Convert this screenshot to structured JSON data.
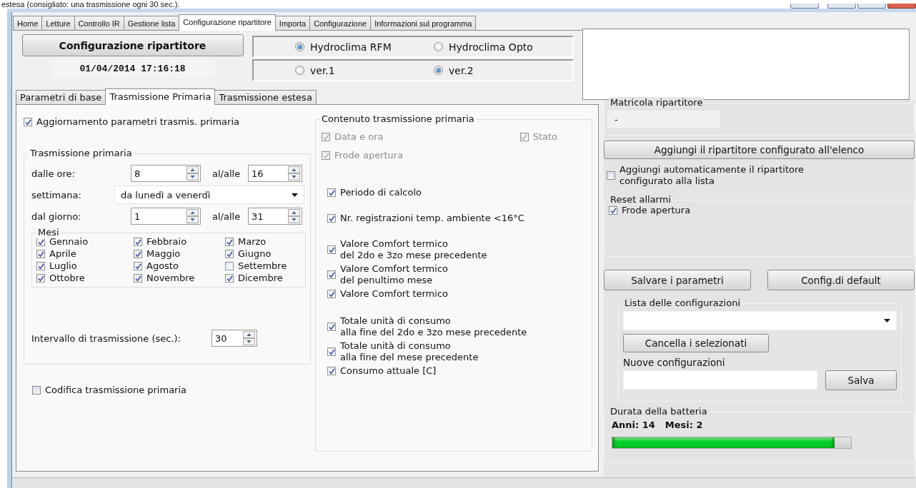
{
  "caption": "estesa (consigliato: una trasmissione ogni 30 sec.).",
  "main_tabs": [
    {
      "label": "Home",
      "selected": false
    },
    {
      "label": "Letture",
      "selected": false
    },
    {
      "label": "Controllo IR",
      "selected": false
    },
    {
      "label": "Gestione lista",
      "selected": false
    },
    {
      "label": "Configurazione ripartitore",
      "selected": true
    },
    {
      "label": "Importa",
      "selected": false
    },
    {
      "label": "Configurazione",
      "selected": false
    },
    {
      "label": "Informazioni sul programma",
      "selected": false
    }
  ],
  "header": {
    "button": "Configurazione ripartitore",
    "datetime": "01/04/2014 17:16:18",
    "device_options": [
      {
        "label": "Hydroclima RFM",
        "selected": true
      },
      {
        "label": "Hydroclima Opto",
        "selected": false
      }
    ],
    "version_options": [
      {
        "label": "ver.1",
        "selected": false
      },
      {
        "label": "ver.2",
        "selected": true
      }
    ]
  },
  "sub_tabs": [
    {
      "label": "Parametri di base",
      "selected": false
    },
    {
      "label": "Trasmissione Primaria",
      "selected": true
    },
    {
      "label": "Trasmissione estesa",
      "selected": false
    }
  ],
  "primary": {
    "update_params": {
      "label": "Aggiornamento parametri trasmis. primaria",
      "checked": true
    },
    "group": {
      "title": "Trasmissione primaria",
      "from_hour": {
        "label": "dalle ore:",
        "value": "8"
      },
      "to_hour": {
        "label": "al/alle",
        "value": "16"
      },
      "week": {
        "label": "settimana:",
        "value": "da lunedì a venerdì"
      },
      "from_day": {
        "label": "dal giorno:",
        "value": "1"
      },
      "to_day": {
        "label": "al/alle",
        "value": "31"
      },
      "months": {
        "title": "Mesi",
        "items": [
          {
            "label": "Gennaio",
            "checked": true
          },
          {
            "label": "Febbraio",
            "checked": true
          },
          {
            "label": "Marzo",
            "checked": true
          },
          {
            "label": "Aprile",
            "checked": true
          },
          {
            "label": "Maggio",
            "checked": true
          },
          {
            "label": "Giugno",
            "checked": true
          },
          {
            "label": "Luglio",
            "checked": true
          },
          {
            "label": "Agosto",
            "checked": true
          },
          {
            "label": "Settembre",
            "checked": false
          },
          {
            "label": "Ottobre",
            "checked": true
          },
          {
            "label": "Novembre",
            "checked": true
          },
          {
            "label": "Dicembre",
            "checked": true
          }
        ]
      },
      "interval": {
        "label": "Intervallo di trasmissione (sec.):",
        "value": "30"
      }
    },
    "encode": {
      "label": "Codifica trasmissione primaria",
      "checked": false
    }
  },
  "content": {
    "title": "Contenuto trasmissione primaria",
    "sections": [
      {
        "kind": "row",
        "items": [
          {
            "label": "Data e ora",
            "checked": true,
            "disabled": true
          },
          {
            "label": "Stato",
            "checked": true,
            "disabled": true
          }
        ]
      },
      {
        "kind": "column",
        "items": [
          {
            "label": "Frode apertura",
            "checked": true,
            "disabled": true
          }
        ]
      },
      {
        "kind": "column",
        "items": [
          {
            "label": "Periodo di calcolo",
            "checked": true,
            "disabled": false
          }
        ]
      },
      {
        "kind": "column",
        "items": [
          {
            "label": "Nr. registrazioni temp. ambiente <16°C",
            "checked": true,
            "disabled": false
          }
        ]
      },
      {
        "kind": "column",
        "items": [
          {
            "label": "Valore Comfort termico\ndel 2do e 3zo mese precedente",
            "checked": true,
            "disabled": false
          },
          {
            "label": "Valore Comfort termico\ndel penultimo mese",
            "checked": true,
            "disabled": false
          },
          {
            "label": "Valore Comfort termico",
            "checked": true,
            "disabled": false
          }
        ]
      },
      {
        "kind": "column",
        "items": [
          {
            "label": "Totale unità di consumo\nalla fine del 2do e 3zo mese precedente",
            "checked": true,
            "disabled": false
          },
          {
            "label": "Totale unità di consumo\nalla fine del mese precedente",
            "checked": true,
            "disabled": false
          },
          {
            "label": "Consumo attuale [C]",
            "checked": true,
            "disabled": false
          }
        ]
      }
    ]
  },
  "serial": {
    "title": "Matricola ripartitore",
    "value": "-"
  },
  "add_button": "Aggiungi il ripartitore configurato all'elenco",
  "auto_add": {
    "label": "Aggiungi automaticamente il ripartitore\nconfigurato alla lista",
    "checked": false
  },
  "reset_alarms": {
    "title": "Reset allarmi",
    "items": [
      {
        "label": "Frode apertura",
        "checked": true
      }
    ]
  },
  "save_button": "Salvare i parametri",
  "default_button": "Config.di default",
  "config_list": {
    "title": "Lista delle configurazioni",
    "delete_button": "Cancella i selezionati",
    "new_label": "Nuove configurazioni",
    "save_button": "Salva"
  },
  "battery": {
    "title": "Durata della batteria",
    "years": "Anni: 14",
    "months": "Mesi: 2",
    "level": 0.93
  }
}
